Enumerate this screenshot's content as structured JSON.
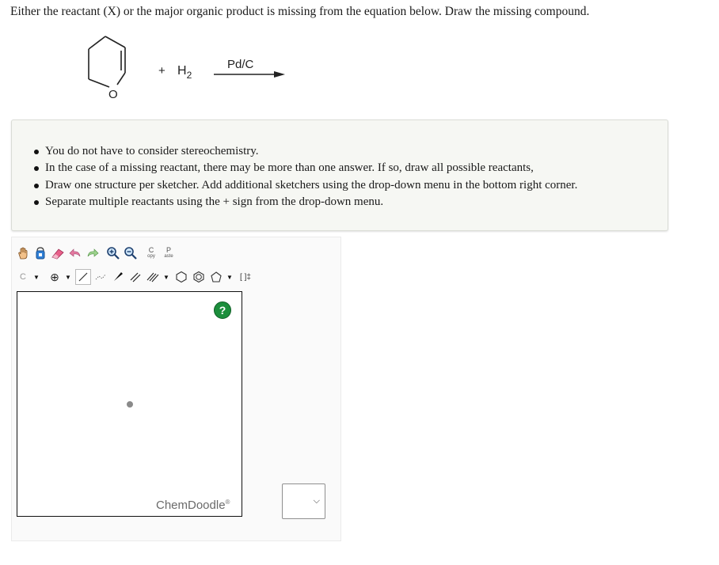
{
  "question": {
    "text": "Either the reactant (X) or the major organic product is missing from the equation below. Draw the missing compound."
  },
  "reaction": {
    "plus": "+",
    "reagent": "H",
    "reagent_sub": "2",
    "condition": "Pd/C",
    "ring_atom": "O"
  },
  "instructions": [
    "You do not have to consider stereochemistry.",
    "In the case of a missing reactant, there may be more than one answer. If so, draw all possible reactants,",
    "Draw one structure per sketcher. Add additional sketchers using the drop-down menu in the bottom right corner.",
    "Separate multiple reactants using the + sign from the drop-down menu."
  ],
  "sketcher": {
    "toolbar_row1": [
      {
        "name": "hand-icon"
      },
      {
        "name": "lasso-icon"
      },
      {
        "name": "eraser-icon"
      },
      {
        "name": "undo-icon"
      },
      {
        "name": "redo-icon"
      },
      {
        "name": "zoom-in-icon"
      },
      {
        "name": "zoom-out-icon"
      },
      {
        "name": "copy-icon",
        "label_top": "C",
        "label_bottom": "opy"
      },
      {
        "name": "paste-icon",
        "label_top": "P",
        "label_bottom": "aste"
      }
    ],
    "toolbar_row2": {
      "atom_label": "C",
      "charge_label": "⊕",
      "bracket_label": "[ ]‡"
    },
    "help_label": "?",
    "brand": "ChemDoodle",
    "brand_mark": "®"
  },
  "dropdown": {
    "value": "",
    "chevron": "⌵"
  }
}
